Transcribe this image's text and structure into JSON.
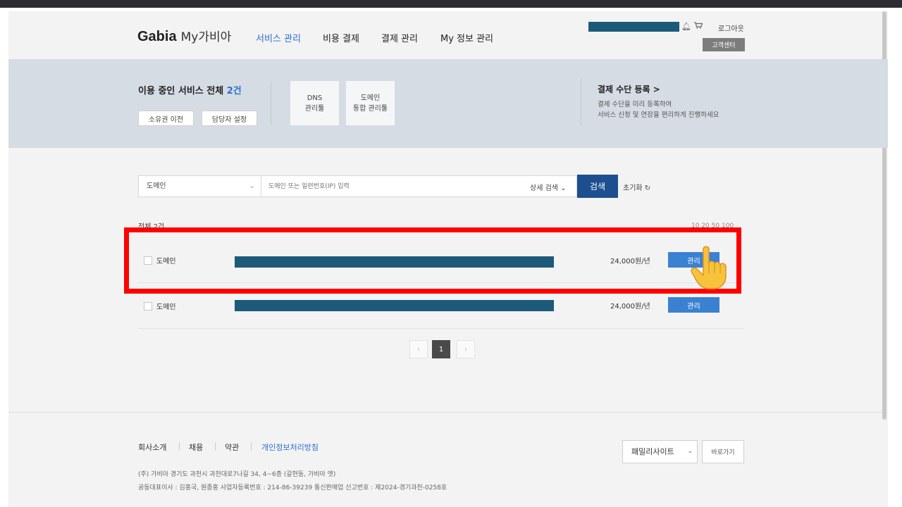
{
  "header": {
    "logo_brand": "Gabia",
    "logo_sub": "My가비아",
    "nav": [
      "서비스 관리",
      "비용 결제",
      "결제 관리",
      "My 정보 관리"
    ],
    "logout": "로그아웃",
    "support": "고객센터"
  },
  "summary": {
    "title_prefix": "이용 중인 서비스 전체",
    "title_count": "2건",
    "btn_transfer": "소유권 이전",
    "btn_manager": "담당자 설정",
    "card_dns_l1": "DNS",
    "card_dns_l2": "관리툴",
    "card_domain_l1": "도메인",
    "card_domain_l2": "통합 관리툴",
    "pay_title": "결제 수단 등록 >",
    "pay_desc_1": "결제 수단을 미리 등록하여",
    "pay_desc_2": "서비스 신청 및 연장을 편리하게 진행하세요"
  },
  "search": {
    "category": "도메인",
    "placeholder": "도메인 또는 일련번호(IP) 입력",
    "detail": "상세 검색",
    "button": "검색",
    "reset": "초기화"
  },
  "list": {
    "total": "전체 2건",
    "page_sizes": "10  20  50  100",
    "rows": [
      {
        "type": "도메인",
        "price": "24,000원/년",
        "action": "관리"
      },
      {
        "type": "도메인",
        "price": "24,000원/년",
        "action": "관리"
      }
    ]
  },
  "pagination": {
    "prev": "‹",
    "current": "1",
    "next": "›"
  },
  "footer": {
    "links": [
      "회사소개",
      "채용",
      "약관",
      "개인정보처리방침"
    ],
    "family": "패밀리사이트",
    "go": "바로가기",
    "addr_1": "(주) 가비아    경기도 과천시 과천대로7나길 34, 4~6층 (갈현동, 가비아 엣)",
    "addr_2": "공동대표이사 : 김홍국, 원종홍     사업자등록번호 : 214-86-39239     통신판매업 신고번호 : 제2024-경기과천-0258호"
  },
  "colors": {
    "accent": "#2b6fd1",
    "primary_button": "#1d4e8f",
    "manage_button": "#3a81d2",
    "highlight": "#ff0000",
    "redaction": "#1d5a7a"
  },
  "icons": [
    "bell-icon",
    "cart-icon",
    "refresh-icon",
    "pointing-hand-icon",
    "chevron-down-icon"
  ]
}
